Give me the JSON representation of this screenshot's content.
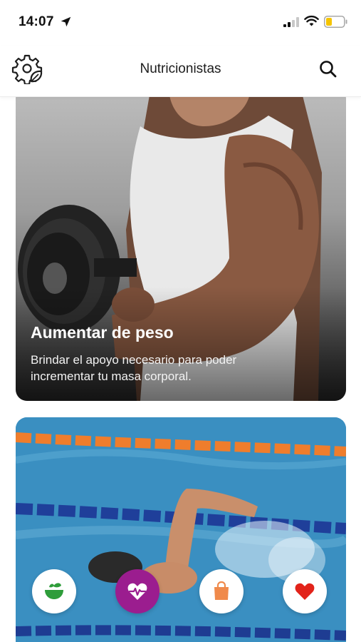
{
  "status_bar": {
    "time": "14:07"
  },
  "header": {
    "title": "Nutricionistas"
  },
  "cards": [
    {
      "title": "Aumentar de peso",
      "description": "Brindar el apoyo necesario para poder incrementar tu masa corporal."
    },
    {
      "title": "",
      "description": ""
    }
  ],
  "bottom_nav": {
    "items": [
      {
        "icon": "salad-bowl-icon",
        "color": "#2e9d3a"
      },
      {
        "icon": "heart-pulse-icon",
        "color": "#9b1d8f",
        "active": true
      },
      {
        "icon": "shopping-bag-icon",
        "color": "#f08a4b"
      },
      {
        "icon": "heart-icon",
        "color": "#e2231a"
      }
    ]
  },
  "colors": {
    "accent": "#9b1d8f",
    "battery_low": "#f5c400"
  }
}
